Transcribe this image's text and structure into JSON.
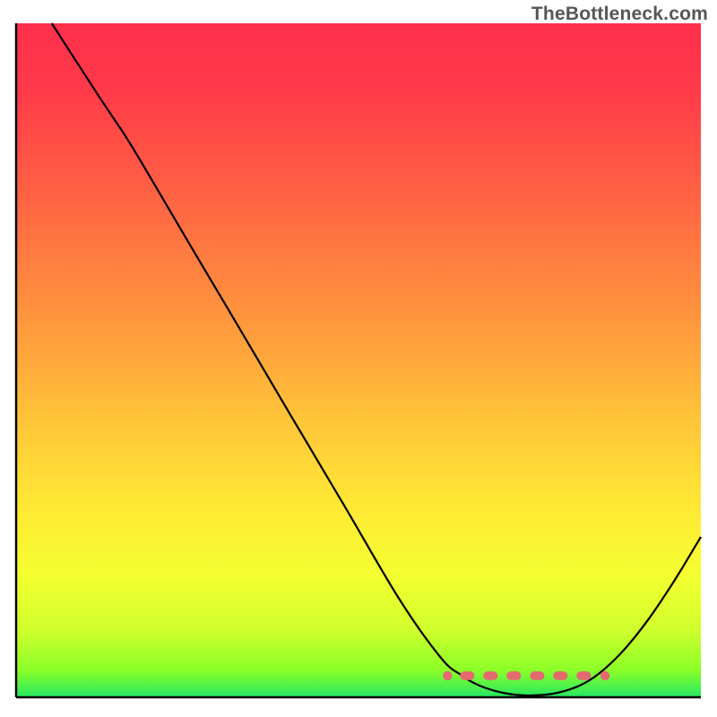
{
  "attribution": "TheBottleneck.com",
  "chart_data": {
    "type": "line",
    "title": "",
    "xlabel": "",
    "ylabel": "",
    "xlim": [
      0,
      100
    ],
    "ylim": [
      0,
      100
    ],
    "curve": [
      {
        "x": 5.2,
        "y": 100
      },
      {
        "x": 12,
        "y": 89.3
      },
      {
        "x": 16,
        "y": 83.2
      },
      {
        "x": 19.1,
        "y": 78
      },
      {
        "x": 25,
        "y": 67.8
      },
      {
        "x": 32,
        "y": 55.8
      },
      {
        "x": 40,
        "y": 42
      },
      {
        "x": 48,
        "y": 28.3
      },
      {
        "x": 56,
        "y": 14.5
      },
      {
        "x": 62,
        "y": 5.9
      },
      {
        "x": 65,
        "y": 3.3
      },
      {
        "x": 68,
        "y": 1.6
      },
      {
        "x": 72,
        "y": 0.5
      },
      {
        "x": 76,
        "y": 0.3
      },
      {
        "x": 80,
        "y": 0.9
      },
      {
        "x": 84,
        "y": 2.7
      },
      {
        "x": 88,
        "y": 6.2
      },
      {
        "x": 92,
        "y": 11.1
      },
      {
        "x": 96,
        "y": 17.1
      },
      {
        "x": 100,
        "y": 23.8
      }
    ],
    "highlight_range": {
      "x_start": 63,
      "x_end": 86,
      "y": 3.2
    },
    "gradient_stops": [
      {
        "offset": 0.0,
        "color": "#ff2f4c"
      },
      {
        "offset": 0.1,
        "color": "#ff3a49"
      },
      {
        "offset": 0.22,
        "color": "#ff5945"
      },
      {
        "offset": 0.35,
        "color": "#ff7d40"
      },
      {
        "offset": 0.48,
        "color": "#ffa23c"
      },
      {
        "offset": 0.6,
        "color": "#ffc838"
      },
      {
        "offset": 0.72,
        "color": "#ffe934"
      },
      {
        "offset": 0.82,
        "color": "#f4ff30"
      },
      {
        "offset": 0.9,
        "color": "#cfff2c"
      },
      {
        "offset": 0.96,
        "color": "#8bff28"
      },
      {
        "offset": 1.0,
        "color": "#24e862"
      }
    ]
  }
}
